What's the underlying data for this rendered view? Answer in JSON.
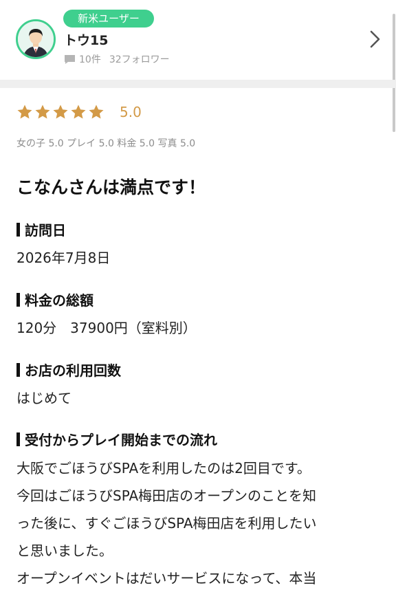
{
  "profile": {
    "badge": "新米ユーザー",
    "username": "トウ15",
    "review_count": "10件",
    "followers": "32フォロワー"
  },
  "review": {
    "stars": 5,
    "score": "5.0",
    "subscores": "女の子 5.0 プレイ 5.0 料金 5.0 写真 5.0",
    "title": "こなんさんは満点です！",
    "sections": [
      {
        "heading": "訪問日",
        "value": "2026年7月8日"
      },
      {
        "heading": "料金の総額",
        "value": "120分　37900円（室料別）"
      },
      {
        "heading": "お店の利用回数",
        "value": "はじめて"
      },
      {
        "heading": "受付からプレイ開始までの流れ"
      }
    ],
    "body_lines": [
      "大阪でごほうびSPAを利用したのは2回目です。",
      "今回はごほうびSPA梅田店のオープンのことを知",
      "った後に、すぐごほうびSPA梅田店を利用したい",
      "と思いました。",
      "オープンイベントはだいサービスになって、本当"
    ]
  },
  "colors": {
    "accent_green": "#3fcf8e",
    "star_gold": "#d39a47",
    "muted_text": "#8c8c8c"
  },
  "icons": {
    "avatar": "user-avatar-icon",
    "reviews": "speech-bubble-icon",
    "chevron": "chevron-right-icon",
    "star": "star-icon"
  }
}
